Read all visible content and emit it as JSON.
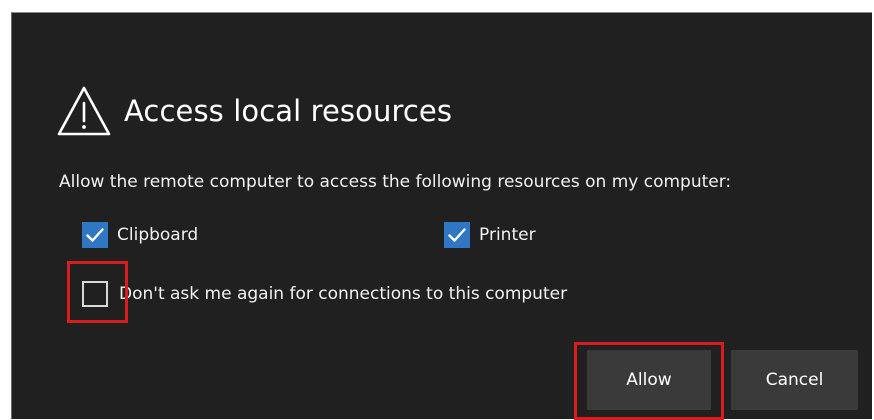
{
  "dialog": {
    "title": "Access local resources",
    "title_icon": "warning-triangle-icon",
    "description": "Allow the remote computer to access the following resources on my computer:",
    "resources": [
      {
        "label": "Clipboard",
        "checked": true
      },
      {
        "label": "Printer",
        "checked": true
      }
    ],
    "dont_ask": {
      "label": "Don't ask me again for connections to this computer",
      "checked": false
    },
    "buttons": {
      "allow_label": "Allow",
      "cancel_label": "Cancel"
    }
  },
  "colors": {
    "dialog_background": "#202020",
    "checkbox_accent": "#2f77c5",
    "button_background": "#3a3a3a",
    "highlight": "#d71d1d",
    "text": "#ffffff"
  }
}
